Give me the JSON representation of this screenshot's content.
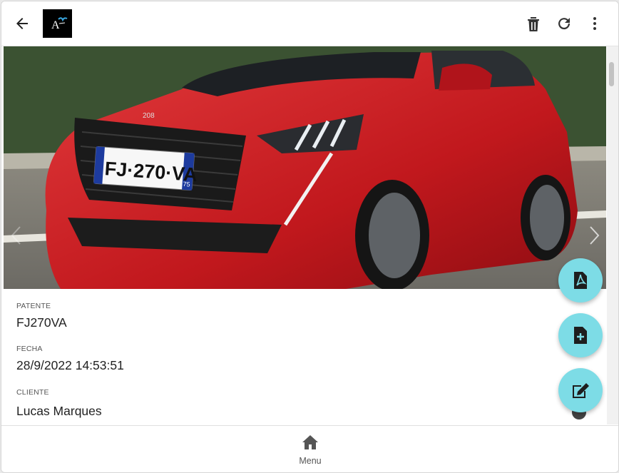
{
  "appbar": {
    "icons": {
      "back": "arrow-left-icon",
      "delete": "trash-icon",
      "refresh": "refresh-icon",
      "more": "more-vertical-icon"
    }
  },
  "hero": {
    "plate": "FJ·270·VA",
    "plate_region": "75",
    "badge": "208"
  },
  "details": {
    "patente_label": "PATENTE",
    "patente_value": "FJ270VA",
    "fecha_label": "FECHA",
    "fecha_value": "28/9/2022 14:53:51",
    "cliente_label": "CLIENTE",
    "cliente_value": "Lucas Marques"
  },
  "fabs": [
    "pdf-icon",
    "add-document-icon",
    "edit-icon"
  ],
  "bottom_nav": {
    "menu_label": "Menu"
  },
  "colors": {
    "fab": "#7ddce6",
    "car": "#c61a20"
  }
}
